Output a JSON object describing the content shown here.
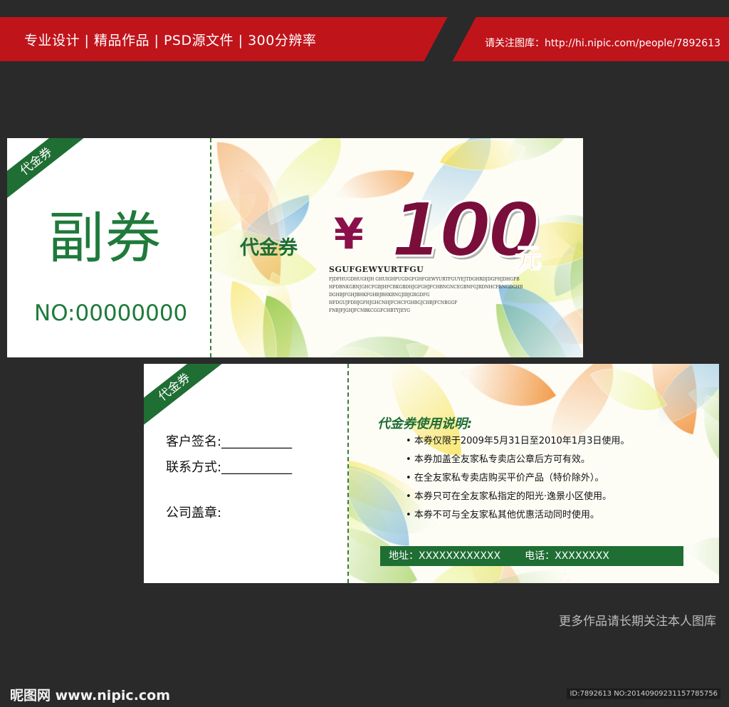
{
  "header": {
    "left_text": "专业设计 | 精品作品 | PSD源文件 | 300分辨率",
    "right_text": "请关注图库：http://hi.nipic.com/people/7892613"
  },
  "voucher_front": {
    "corner_label": "代金券",
    "stub_title": "副券",
    "serial": "NO:00000000",
    "label": "代金券",
    "currency_symbol": "¥",
    "amount": "100",
    "unit": "元",
    "code": "SGUFGEWYURTFGU",
    "fine_print": [
      "FJDFHUGDHUGHJH GHUIGHFUGDGFGHFGEWYURTFGUYEJTDGHRDJDGFHJDHGFB",
      "HFDBNKGBNJGHCFGBJHFCBKGBDHJGFGHJFCHBNGNCEGBNFGJRDNHCFBNGDGHB",
      "DGHBJFGHJBHKFGHBJBHKBNGJIBJGRGDFG",
      "HFDGUJFDHJGFHJGHCNHJFCHCFGHBGJCHBJFCNBGGF",
      "FNBJFJGHJFCNBKCGGFCHBTYJEYG"
    ],
    "leaf_colors": [
      "#8ec63f",
      "#f6e04a",
      "#f08a2c",
      "#5aa6d8",
      "#7fbf4a",
      "#e6f07a"
    ]
  },
  "voucher_back": {
    "corner_label": "代金券",
    "fields": [
      "客户签名:___________",
      "联系方式:___________",
      "公司盖章:"
    ],
    "usage_title": "代金券使用说明:",
    "rules": [
      "本券仅限于2009年5月31日至2010年1月3日使用。",
      "本券加盖全友家私专卖店公章后方可有效。",
      "在全友家私专卖店购买平价产品（特价除外）。",
      "本券只可在全友家私指定的阳光·逸景小区使用。",
      "本券不可与全友家私其他优惠活动同时使用。"
    ],
    "address": "地址：XXXXXXXXXXXX",
    "phone": "电话：XXXXXXXX"
  },
  "footer": {
    "more_works": "更多作品请长期关注本人图库",
    "logo": "昵图网 www.nipic.com",
    "id_line": "ID:7892613 NO:20140909231157785756"
  }
}
